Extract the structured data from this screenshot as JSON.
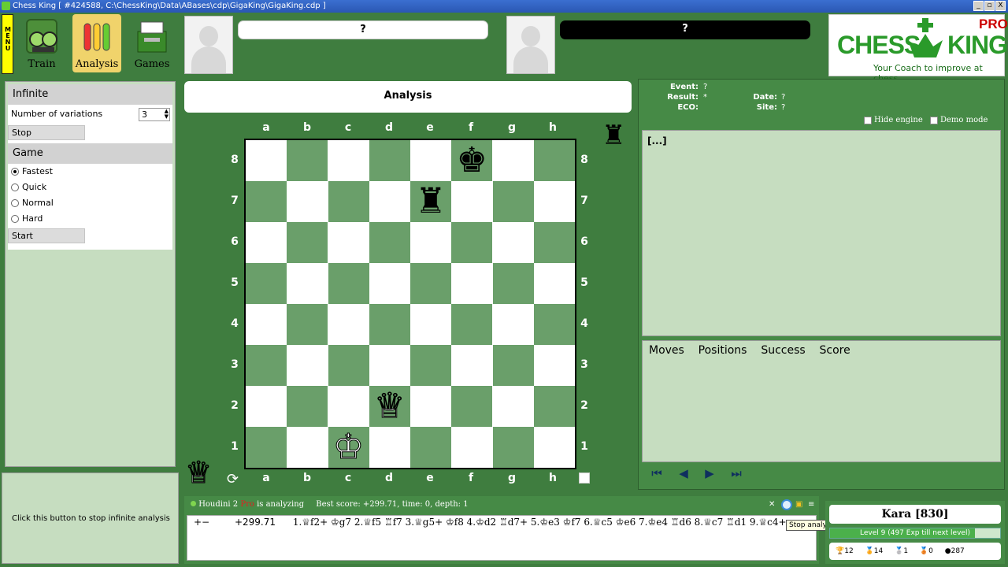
{
  "window": {
    "title": "Chess King [ #424588, C:\\ChessKing\\Data\\ABases\\cdp\\GigaKing\\GigaKing.cdp ]",
    "min": "_",
    "max": "▫",
    "close": "X"
  },
  "menu_label": "MENU",
  "toolbar": {
    "train": "Train",
    "analysis": "Analysis",
    "games": "Games"
  },
  "players": {
    "white_name": "?",
    "black_name": "?"
  },
  "logo": {
    "text1": "CHESS",
    "text2": "KING",
    "badge": "PRO",
    "tagline": "Your Coach to improve at chess"
  },
  "left_panel": {
    "infinite_header": "Infinite",
    "variations_label": "Number of variations",
    "variations_value": "3",
    "stop_label": "Stop",
    "game_header": "Game",
    "options": [
      "Fastest",
      "Quick",
      "Normal",
      "Hard"
    ],
    "selected_option": "Fastest",
    "start_label": "Start",
    "hint": "Click this button to stop infinite analysis"
  },
  "analysis_title": "Analysis",
  "board": {
    "files": [
      "a",
      "b",
      "c",
      "d",
      "e",
      "f",
      "g",
      "h"
    ],
    "ranks": [
      "8",
      "7",
      "6",
      "5",
      "4",
      "3",
      "2",
      "1"
    ],
    "pieces": [
      {
        "square": "f8",
        "glyph": "♚",
        "color": "black",
        "name": "black-king"
      },
      {
        "square": "e7",
        "glyph": "♜",
        "color": "black",
        "name": "black-rook"
      },
      {
        "square": "d2",
        "glyph": "♕",
        "color": "white",
        "name": "white-queen"
      },
      {
        "square": "c1",
        "glyph": "♔",
        "color": "white",
        "name": "white-king"
      }
    ],
    "promo_black": "♜",
    "promo_white": "♕"
  },
  "game_info": {
    "event_label": "Event:",
    "event": "?",
    "result_label": "Result:",
    "result": "*",
    "eco_label": "ECO:",
    "eco": "",
    "date_label": "Date:",
    "date": "?",
    "site_label": "Site:",
    "site": "?",
    "hide_engine": "Hide engine",
    "demo_mode": "Demo mode"
  },
  "notation": "[...]",
  "tabs": [
    "Moves",
    "Positions",
    "Success",
    "Score"
  ],
  "engine": {
    "name": "Houdini 2",
    "pro": "Pro",
    "status": "is analyzing",
    "best": "Best score: +299.71, time: 0, depth: 1",
    "eval_sign": "+−",
    "eval": "+299.71",
    "line": "1.♕f2+ ♔g7 2.♕f5 ♖f7 3.♕g5+ ♔f8 4.♔d2 ♖d7+ 5.♔e3 ♔f7 6.♕c5 ♔e6 7.♔e4 ♖d6 8.♕c7 ♖d1 9.♕c4+",
    "tooltip": "Stop analysis"
  },
  "user": {
    "name": "Kara [830]",
    "level": "Level 9 (497 Exp till next level)",
    "level_progress": 0.85,
    "stats": [
      "12",
      "14",
      "1",
      "0",
      "287"
    ]
  }
}
